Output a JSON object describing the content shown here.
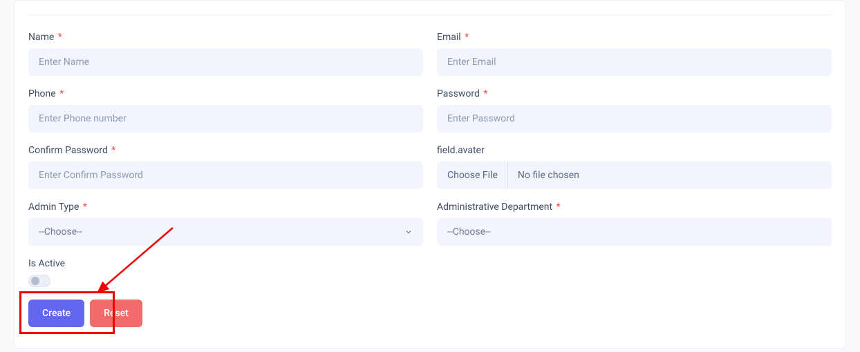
{
  "fields": {
    "name": {
      "label": "Name",
      "placeholder": "Enter Name",
      "required": true
    },
    "email": {
      "label": "Email",
      "placeholder": "Enter Email",
      "required": true
    },
    "phone": {
      "label": "Phone",
      "placeholder": "Enter Phone number",
      "required": true
    },
    "password": {
      "label": "Password",
      "placeholder": "Enter Password",
      "required": true
    },
    "confirm_password": {
      "label": "Confirm Password",
      "placeholder": "Enter Confirm Password",
      "required": true
    },
    "avatar": {
      "label": "field.avater",
      "choose_btn": "Choose File",
      "no_file": "No file chosen",
      "required": false
    },
    "admin_type": {
      "label": "Admin Type",
      "placeholder": "--Choose--",
      "required": true
    },
    "department": {
      "label": "Administrative Department",
      "placeholder": "--Choose--",
      "required": true
    },
    "is_active": {
      "label": "Is Active"
    }
  },
  "buttons": {
    "create": "Create",
    "reset": "Reset"
  },
  "required_marker": "*"
}
